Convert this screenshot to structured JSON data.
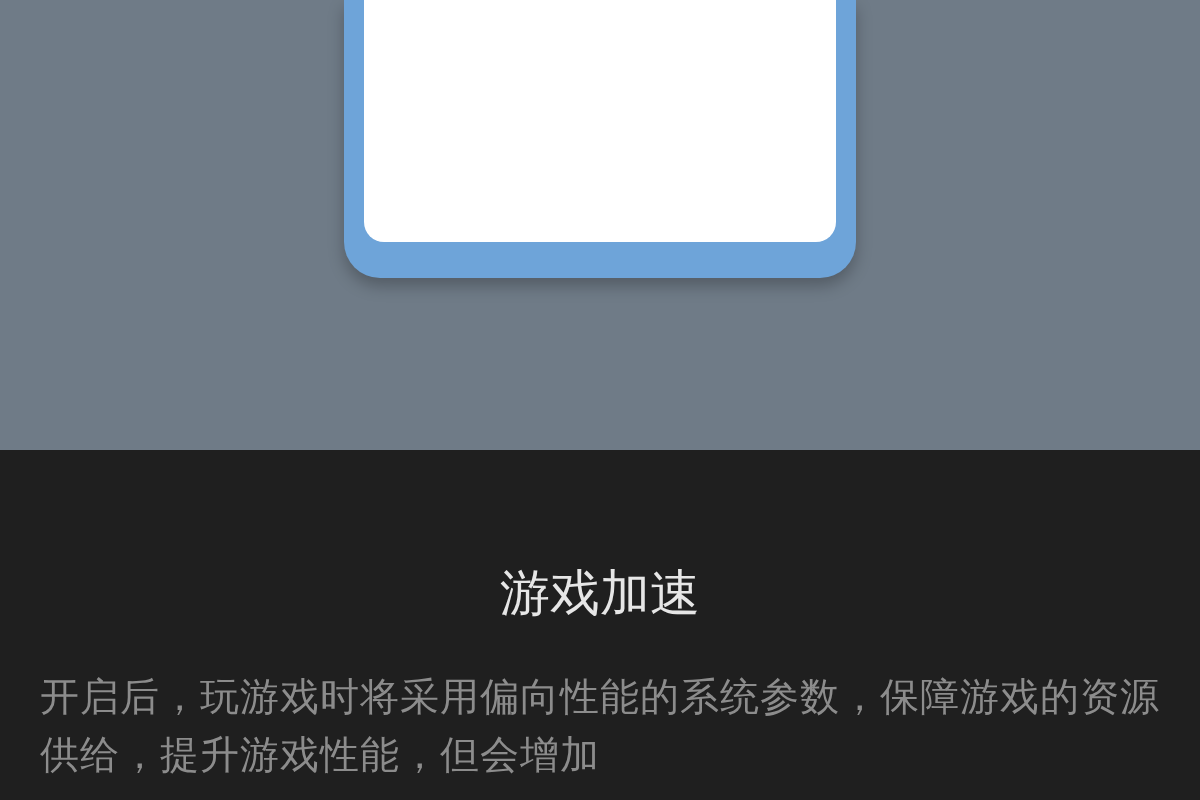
{
  "dialog": {
    "title": "游戏加速",
    "description": "开启后，玩游戏时将采用偏向性能的系统参数，保障游戏的资源供给，提升游戏性能，但会增加"
  }
}
